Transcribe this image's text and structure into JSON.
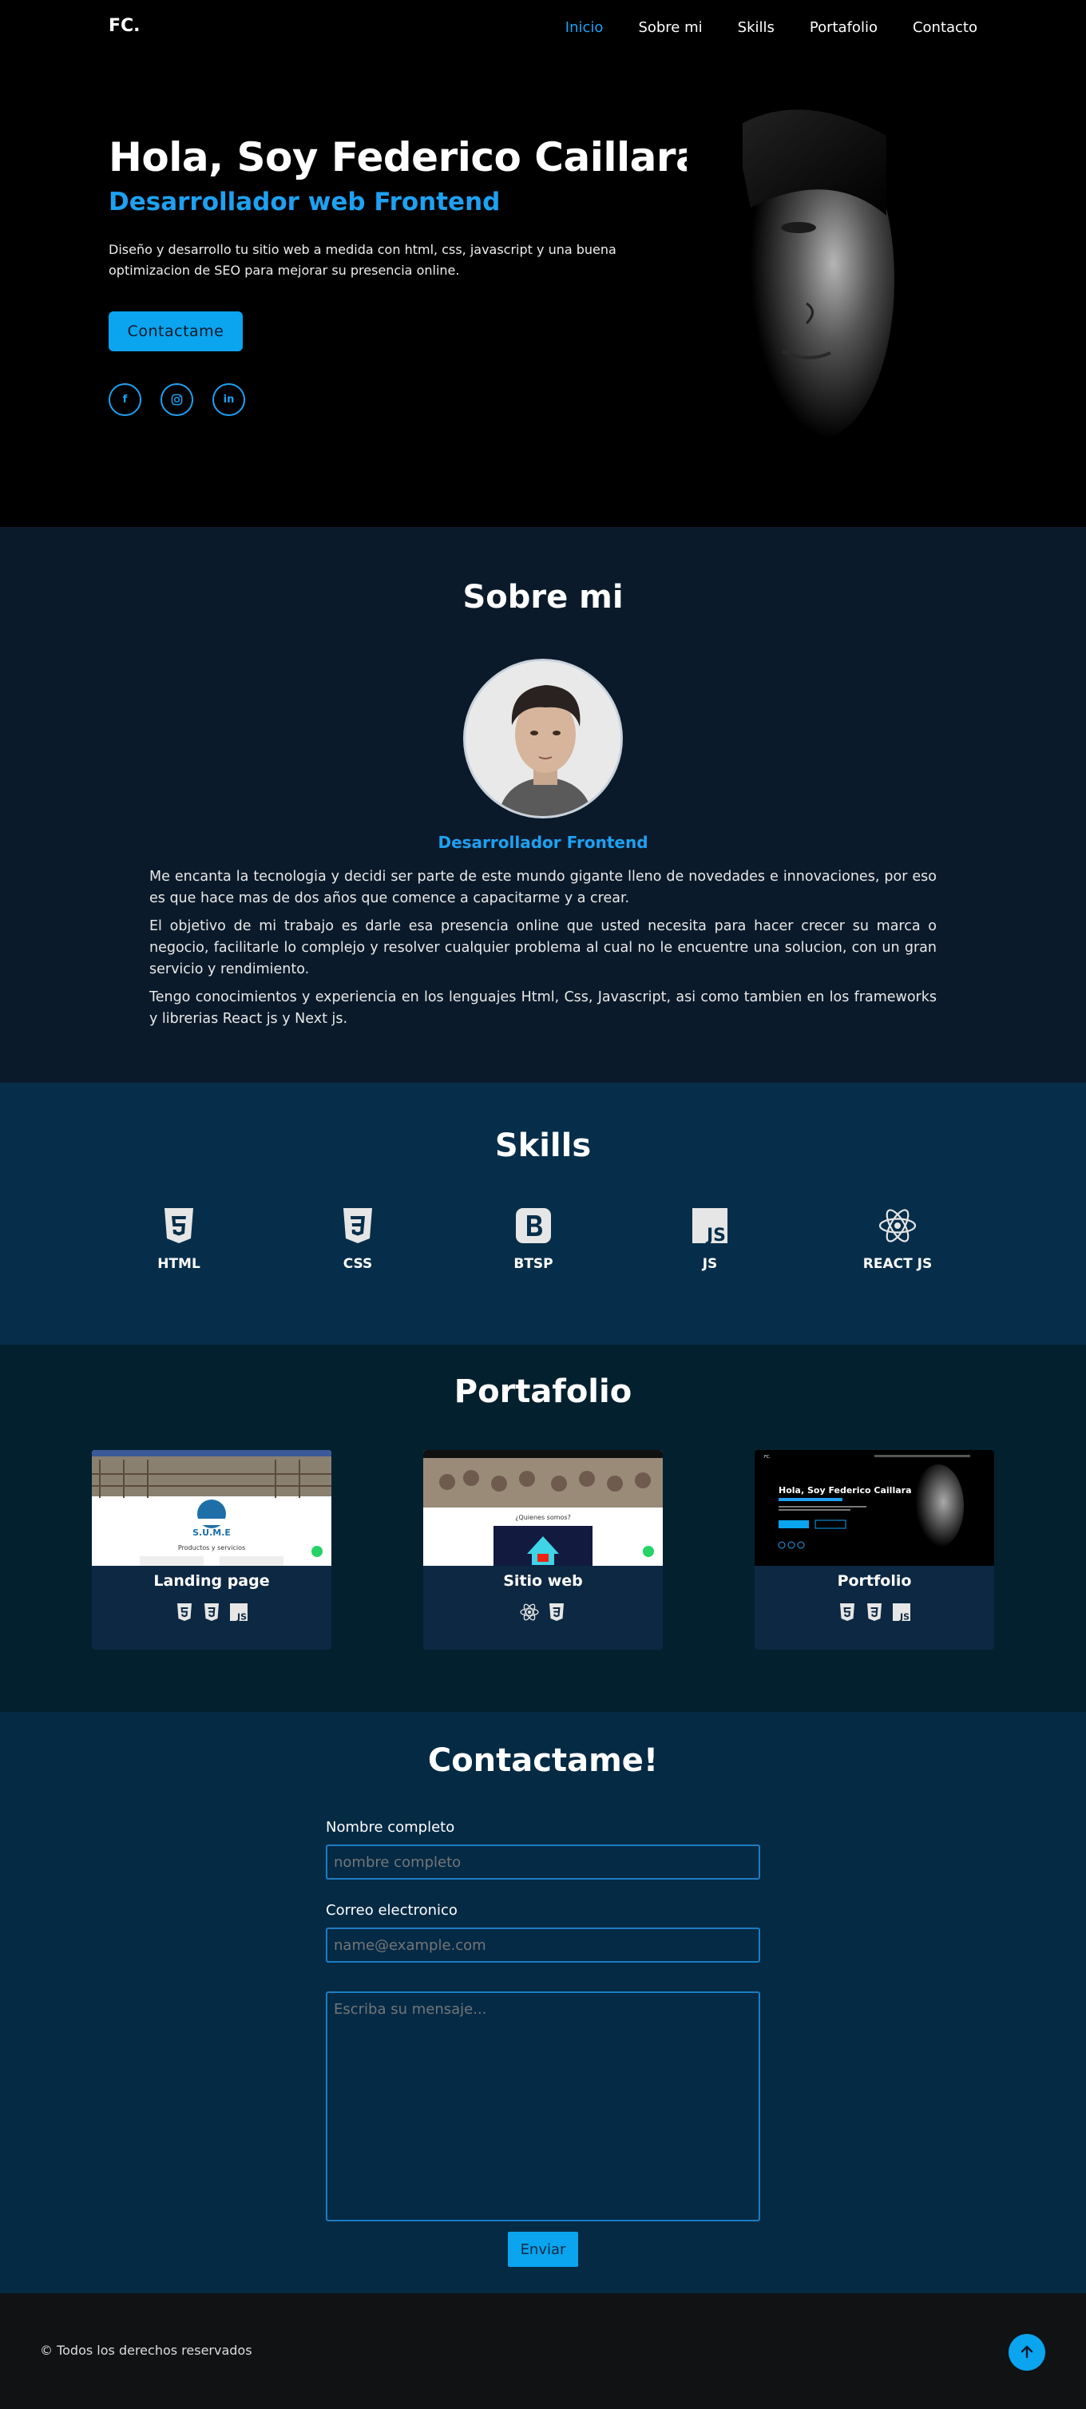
{
  "nav": {
    "brand": "FC.",
    "items": [
      "Inicio",
      "Sobre mi",
      "Skills",
      "Portafolio",
      "Contacto"
    ],
    "active": "Inicio"
  },
  "hero": {
    "title": "Hola, Soy Federico Caillara",
    "subtitle": "Desarrollador web Frontend",
    "description": "Diseño y desarrollo tu sitio web a medida con html, css, javascript y una buena optimizacion de SEO para mejorar su presencia online.",
    "cta": "Contactame",
    "socials": [
      "facebook-icon",
      "instagram-icon",
      "linkedin-icon"
    ]
  },
  "about": {
    "title": "Sobre mi",
    "role": "Desarrollador Frontend",
    "paragraphs": [
      "Me encanta la tecnologia y decidi ser parte de este mundo gigante lleno de novedades e innovaciones, por eso es que hace mas de dos años que comence a capacitarme y a crear.",
      "El objetivo de mi trabajo es darle esa presencia online que usted necesita para hacer crecer su marca o negocio, facilitarle lo complejo y resolver cualquier problema al cual no le encuentre una solucion, con un gran servicio y rendimiento.",
      "Tengo conocimientos y experiencia en los lenguajes Html, Css, Javascript, asi como tambien en los frameworks y librerias React js y Next js."
    ]
  },
  "skills": {
    "title": "Skills",
    "items": [
      "HTML",
      "CSS",
      "BTSP",
      "JS",
      "REACT JS"
    ]
  },
  "portfolio": {
    "title": "Portafolio",
    "cards": [
      {
        "title": "Landing page",
        "shot_caption": "Productos y servicios",
        "logo_text": "S.U.M.E",
        "icons": [
          "html5-icon",
          "css3-icon",
          "js-icon"
        ]
      },
      {
        "title": "Sitio web",
        "shot_caption": "¿Quienes somos?",
        "icons": [
          "react-icon",
          "css3-icon"
        ]
      },
      {
        "title": "Portfolio",
        "shot_caption": "Hola, Soy Federico Caillara",
        "icons": [
          "html5-icon",
          "css3-icon",
          "js-icon"
        ]
      }
    ]
  },
  "contact": {
    "title": "Contactame!",
    "name_label": "Nombre completo",
    "name_placeholder": "nombre completo",
    "email_label": "Correo electronico",
    "email_placeholder": "name@example.com",
    "message_placeholder": "Escriba su mensaje...",
    "submit": "Enviar"
  },
  "footer": {
    "copyright": "© Todos los derechos reservados"
  },
  "colors": {
    "accent": "#1ea1f2",
    "hero_bg": "#000000",
    "about_bg": "#0b1a2a",
    "skills_bg": "#062e4a",
    "portfolio_bg": "#03202f",
    "contact_bg": "#042a44",
    "footer_bg": "#111214"
  }
}
